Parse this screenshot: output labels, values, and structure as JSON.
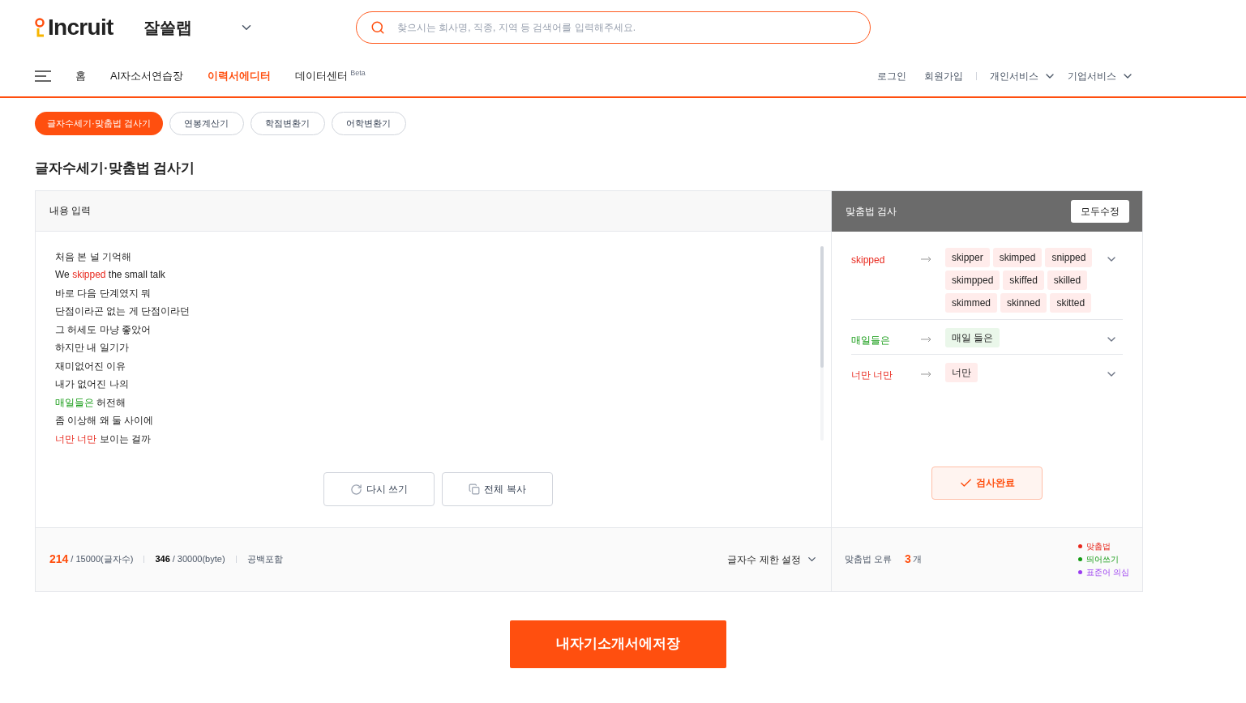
{
  "header": {
    "logo": "Incruit",
    "service": "잘쓸랩",
    "search": {
      "placeholder": "찾으시는 회사명, 직종, 지역 등 검색어를 입력해주세요."
    }
  },
  "nav": {
    "items": [
      {
        "label": "홈",
        "selected": false
      },
      {
        "label": "AI자소서연습장",
        "selected": false
      },
      {
        "label": "이력서에디터",
        "selected": true
      },
      {
        "label": "데이터센터",
        "badge": "Beta",
        "selected": false
      }
    ],
    "account": [
      "로그인",
      "회원가입"
    ],
    "services": [
      "개인서비스",
      "기업서비스"
    ]
  },
  "tools": [
    {
      "label": "글자수세기·맞춤법 검사기",
      "selected": true
    },
    {
      "label": "연봉계산기",
      "selected": false
    },
    {
      "label": "학점변환기",
      "selected": false
    },
    {
      "label": "어학변환기",
      "selected": false
    }
  ],
  "page_title": "글자수세기·맞춤법 검사기",
  "editor": {
    "title": "내용 입력",
    "lines": [
      [
        {
          "text": "처음 본 널 기억해",
          "kind": "plain"
        }
      ],
      [
        {
          "text": "We ",
          "kind": "plain"
        },
        {
          "text": "skipped",
          "kind": "spelling"
        },
        {
          "text": " the small talk",
          "kind": "plain"
        }
      ],
      [
        {
          "text": "바로 다음 단계였지 뭐",
          "kind": "plain"
        }
      ],
      [
        {
          "text": "단점이라곤 없는 게 단점이라던",
          "kind": "plain"
        }
      ],
      [
        {
          "text": "그 허세도 마냥 좋았어",
          "kind": "plain"
        }
      ],
      [
        {
          "text": "하지만 내 일기가",
          "kind": "plain"
        }
      ],
      [
        {
          "text": "재미없어진 이유",
          "kind": "plain"
        }
      ],
      [
        {
          "text": "내가 없어진 나의",
          "kind": "plain"
        }
      ],
      [
        {
          "text": "매일들은",
          "kind": "spacing"
        },
        {
          "text": " 허전해",
          "kind": "plain"
        }
      ],
      [
        {
          "text": "좀 이상해 왜 둘 사이에",
          "kind": "plain"
        }
      ],
      [
        {
          "text": "너만 너만",
          "kind": "spelling"
        },
        {
          "text": " 보이는 걸까",
          "kind": "plain"
        }
      ]
    ],
    "buttons": [
      "다시 쓰기",
      "전체 복사"
    ],
    "char_count": "214",
    "char_limit": "/ 15000(글자수)",
    "byte_count": "346",
    "byte_limit": "/ 30000(byte)",
    "whitespace": "공백포함",
    "limit_setting": "글자수 제한 설정"
  },
  "checker": {
    "title": "맞춤법 검사",
    "fix_all": "모두수정",
    "errors": [
      {
        "word": "skipped",
        "kind": "spelling",
        "suggestions": [
          "skipper",
          "skimped",
          "snipped",
          "skimpped",
          "skiffed",
          "skilled",
          "skimmed",
          "skinned",
          "skitted"
        ]
      },
      {
        "word": "매일들은",
        "kind": "spacing",
        "suggestions": [
          "매일 들은"
        ]
      },
      {
        "word": "너만 너만",
        "kind": "spelling",
        "suggestions": [
          "너만"
        ]
      }
    ],
    "done": "검사완료",
    "error_label": "맞춤법 오류",
    "error_count": "3",
    "error_unit": "개",
    "legend": [
      {
        "label": "맞춤법",
        "color": "#e8271c"
      },
      {
        "label": "띄어쓰기",
        "color": "#129a12"
      },
      {
        "label": "표준어 의심",
        "color": "#9a3cf0"
      }
    ]
  },
  "save_button": "내자기소개서에저장"
}
